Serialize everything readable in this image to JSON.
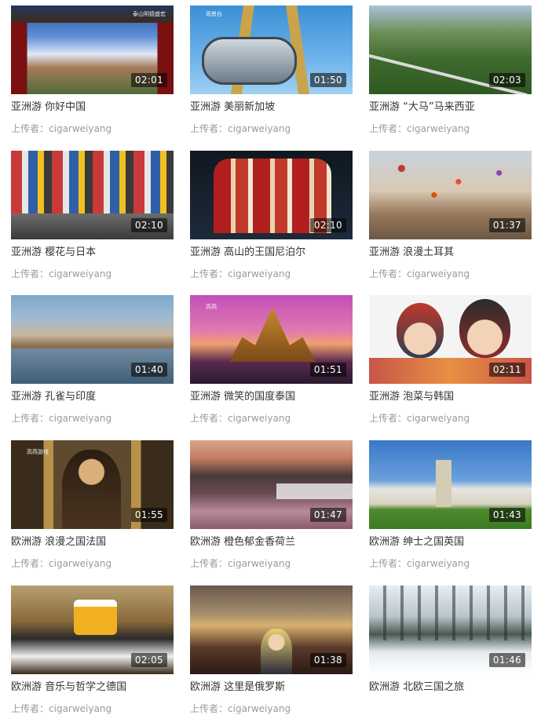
{
  "uploader_prefix": "上传者：",
  "videos": [
    {
      "title": "亚洲游 你好中国",
      "duration": "02:01",
      "uploader": "cigarweiyang",
      "overlay": "泰山明德盛宏"
    },
    {
      "title": "亚洲游 美丽新加坡",
      "duration": "01:50",
      "uploader": "cigarweiyang",
      "overlay": "观景台"
    },
    {
      "title": "亚洲游 “大马”马来西亚",
      "duration": "02:03",
      "uploader": "cigarweiyang"
    },
    {
      "title": "亚洲游 樱花与日本",
      "duration": "02:10",
      "uploader": "cigarweiyang"
    },
    {
      "title": "亚洲游 高山的王国尼泊尔",
      "duration": "02:10",
      "uploader": "cigarweiyang"
    },
    {
      "title": "亚洲游 浪漫土耳其",
      "duration": "01:37",
      "uploader": "cigarweiyang"
    },
    {
      "title": "亚洲游 孔雀与印度",
      "duration": "01:40",
      "uploader": "cigarweiyang"
    },
    {
      "title": "亚洲游 微笑的国度泰国",
      "duration": "01:51",
      "uploader": "cigarweiyang",
      "overlay": "高燕"
    },
    {
      "title": "亚洲游 泡菜与韩国",
      "duration": "02:11",
      "uploader": "cigarweiyang"
    },
    {
      "title": "欧洲游 浪漫之国法国",
      "duration": "01:55",
      "uploader": "cigarweiyang",
      "overlay": "高燕游戏"
    },
    {
      "title": "欧洲游 橙色郁金香荷兰",
      "duration": "01:47",
      "uploader": "cigarweiyang"
    },
    {
      "title": "欧洲游 绅士之国英国",
      "duration": "01:43",
      "uploader": "cigarweiyang"
    },
    {
      "title": "欧洲游 音乐与哲学之德国",
      "duration": "02:05",
      "uploader": "cigarweiyang"
    },
    {
      "title": "欧洲游 这里是俄罗斯",
      "duration": "01:38",
      "uploader": "cigarweiyang"
    },
    {
      "title": "欧洲游 北欧三国之旅",
      "duration": "01:46",
      "uploader": "cigarweiyang"
    }
  ]
}
